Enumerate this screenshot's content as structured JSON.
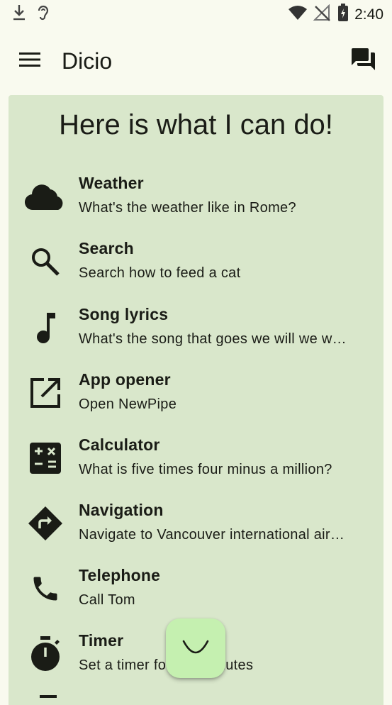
{
  "status_bar": {
    "time": "2:40",
    "icons": [
      "download-icon",
      "hearing-icon",
      "wifi-icon",
      "no-signal-icon",
      "battery-charging-icon"
    ]
  },
  "app_bar": {
    "title": "Dicio",
    "menu_icon": "menu-icon",
    "action_icon": "chat-icon"
  },
  "card": {
    "title": "Here is what I can do!",
    "background": "#d9e7cb"
  },
  "skills": [
    {
      "name": "Weather",
      "example": "What's the weather like in Rome?",
      "icon": "cloud-icon"
    },
    {
      "name": "Search",
      "example": "Search how to feed a cat",
      "icon": "search-icon"
    },
    {
      "name": "Song lyrics",
      "example": "What's the song that goes we will we w…",
      "icon": "music-note-icon"
    },
    {
      "name": "App opener",
      "example": "Open NewPipe",
      "icon": "open-in-new-icon"
    },
    {
      "name": "Calculator",
      "example": "What is five times four minus a million?",
      "icon": "calculator-icon"
    },
    {
      "name": "Navigation",
      "example": "Navigate to Vancouver international air…",
      "icon": "directions-icon"
    },
    {
      "name": "Telephone",
      "example": "Call Tom",
      "icon": "phone-icon"
    },
    {
      "name": "Timer",
      "example": "Set a timer for five minutes",
      "icon": "timer-icon"
    }
  ],
  "fab": {
    "icon": "listening-icon",
    "color": "#c5f0b0"
  }
}
